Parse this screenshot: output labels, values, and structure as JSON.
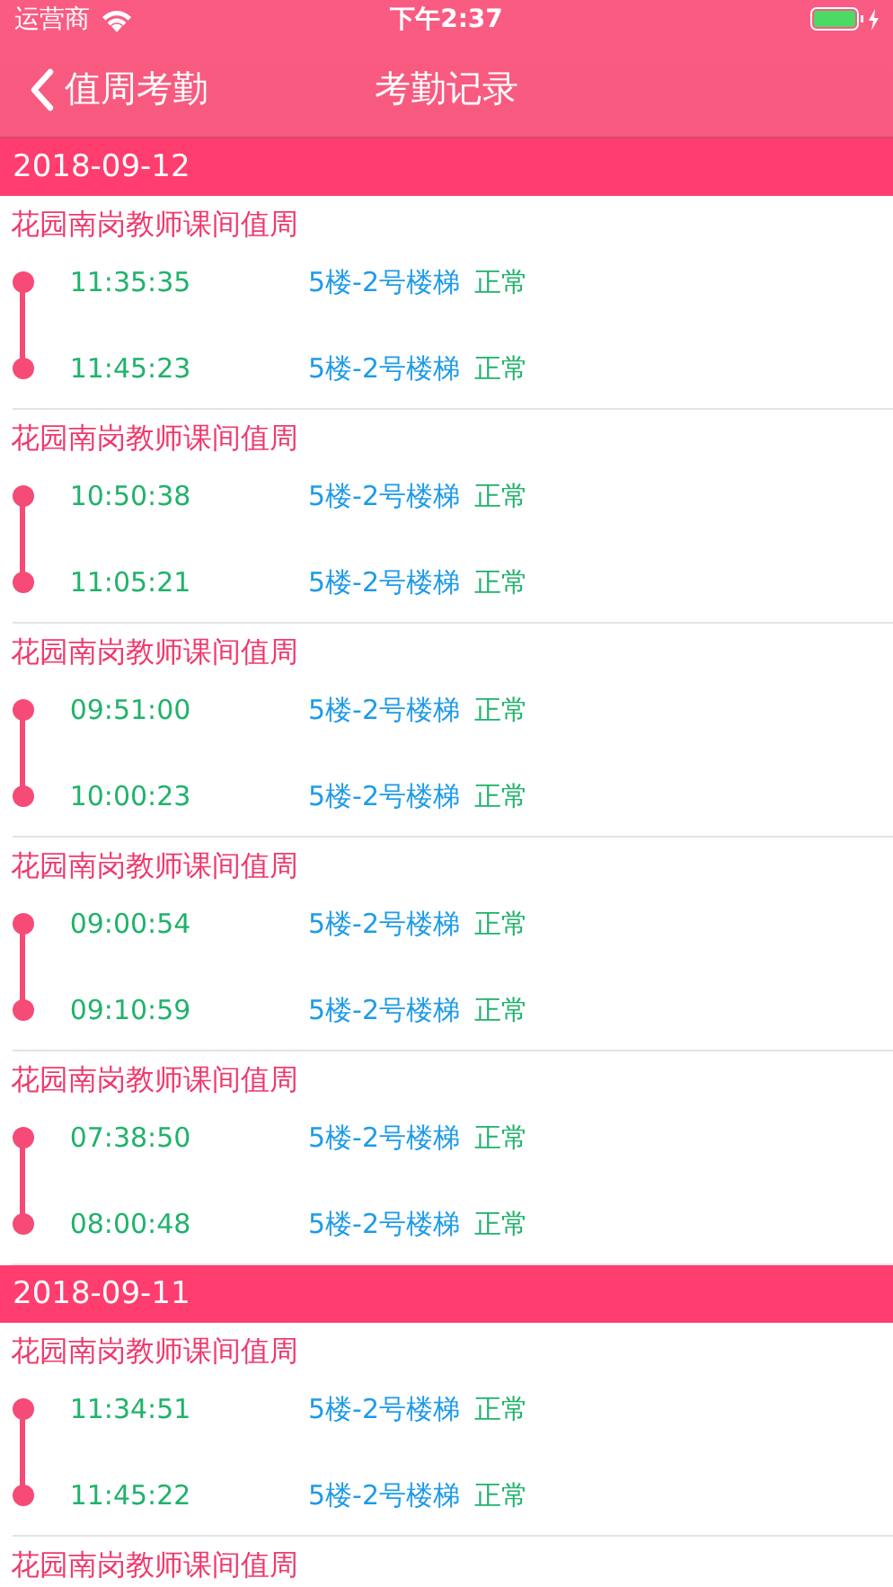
{
  "status_bar": {
    "carrier": "运营商",
    "time": "下午2:37"
  },
  "nav": {
    "back": "值周考勤",
    "title": "考勤记录"
  },
  "days": [
    {
      "date": "2018-09-12",
      "records": [
        {
          "title": "花园南岗教师课间值周",
          "punches": [
            {
              "time": "11:35:35",
              "location": "5楼-2号楼梯",
              "status": "正常"
            },
            {
              "time": "11:45:23",
              "location": "5楼-2号楼梯",
              "status": "正常"
            }
          ]
        },
        {
          "title": "花园南岗教师课间值周",
          "punches": [
            {
              "time": "10:50:38",
              "location": "5楼-2号楼梯",
              "status": "正常"
            },
            {
              "time": "11:05:21",
              "location": "5楼-2号楼梯",
              "status": "正常"
            }
          ]
        },
        {
          "title": "花园南岗教师课间值周",
          "punches": [
            {
              "time": "09:51:00",
              "location": "5楼-2号楼梯",
              "status": "正常"
            },
            {
              "time": "10:00:23",
              "location": "5楼-2号楼梯",
              "status": "正常"
            }
          ]
        },
        {
          "title": "花园南岗教师课间值周",
          "punches": [
            {
              "time": "09:00:54",
              "location": "5楼-2号楼梯",
              "status": "正常"
            },
            {
              "time": "09:10:59",
              "location": "5楼-2号楼梯",
              "status": "正常"
            }
          ]
        },
        {
          "title": "花园南岗教师课间值周",
          "punches": [
            {
              "time": "07:38:50",
              "location": "5楼-2号楼梯",
              "status": "正常"
            },
            {
              "time": "08:00:48",
              "location": "5楼-2号楼梯",
              "status": "正常"
            }
          ]
        }
      ]
    },
    {
      "date": "2018-09-11",
      "records": [
        {
          "title": "花园南岗教师课间值周",
          "punches": [
            {
              "time": "11:34:51",
              "location": "5楼-2号楼梯",
              "status": "正常"
            },
            {
              "time": "11:45:22",
              "location": "5楼-2号楼梯",
              "status": "正常"
            }
          ]
        },
        {
          "title": "花园南岗教师课间值周"
        }
      ]
    }
  ]
}
